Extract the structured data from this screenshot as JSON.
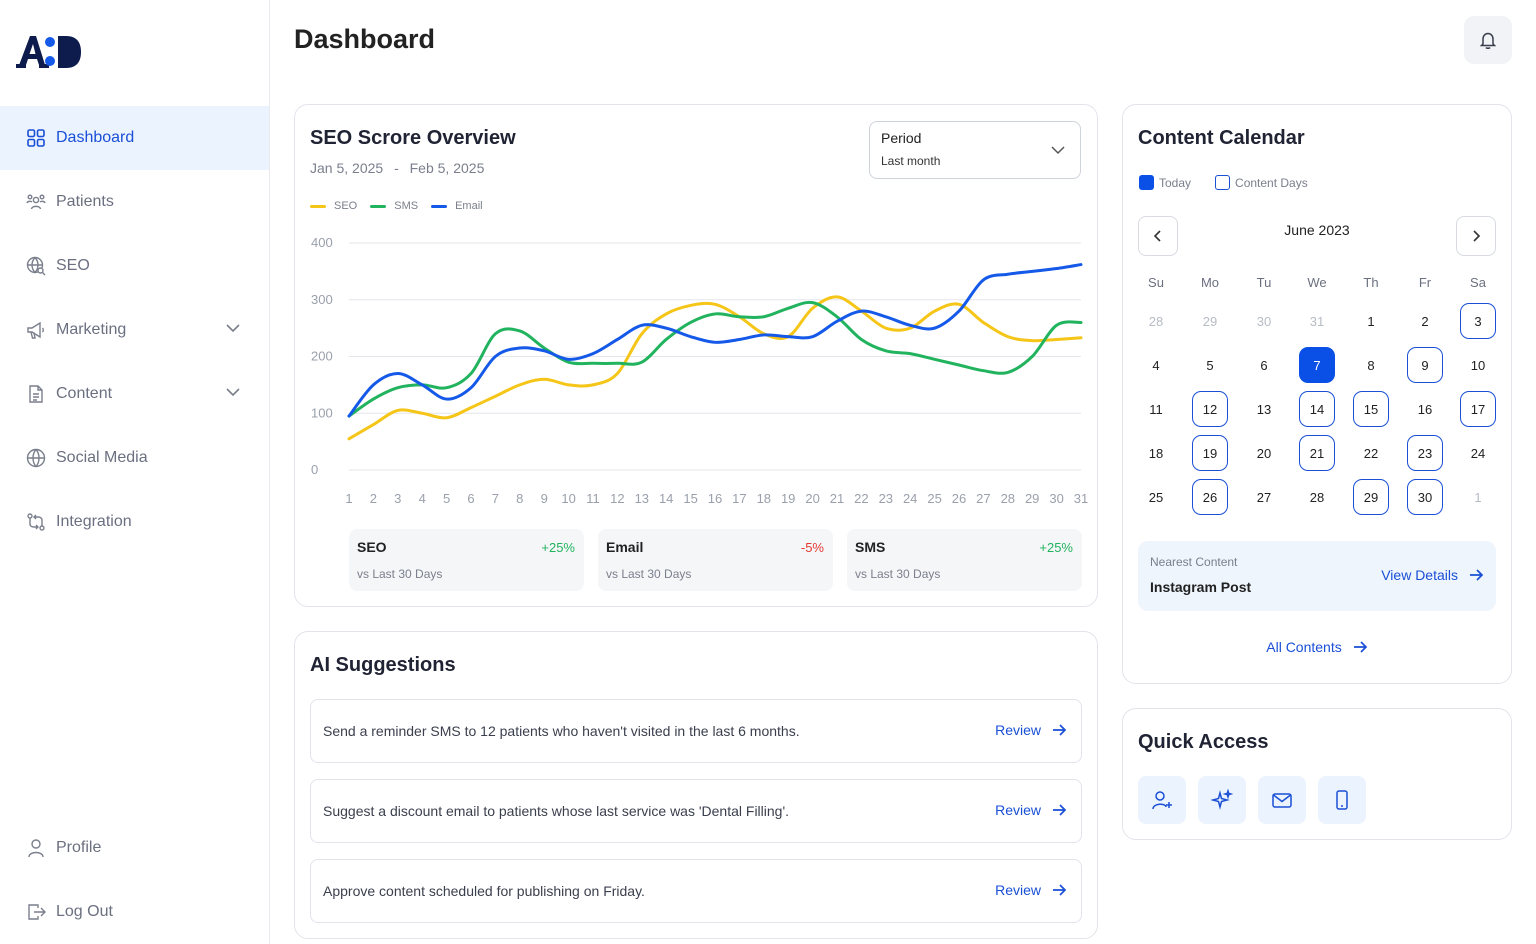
{
  "sidebar": {
    "items": [
      {
        "label": "Dashboard"
      },
      {
        "label": "Patients"
      },
      {
        "label": "SEO"
      },
      {
        "label": "Marketing"
      },
      {
        "label": "Content"
      },
      {
        "label": "Social Media"
      },
      {
        "label": "Integration"
      }
    ],
    "profile_label": "Profile",
    "logout_label": "Log Out"
  },
  "header": {
    "title": "Dashboard"
  },
  "seo_card": {
    "title": "SEO Scrore Overview",
    "date_start": "Jan 5, 2025",
    "date_sep": "-",
    "date_end": "Feb 5, 2025",
    "period_label": "Period",
    "period_value": "Last month",
    "legend": [
      "SEO",
      "SMS",
      "Email"
    ],
    "stats": [
      {
        "name": "SEO",
        "change": "+25%",
        "sub": "vs Last 30 Days"
      },
      {
        "name": "Email",
        "change": "-5%",
        "sub": "vs Last 30 Days"
      },
      {
        "name": "SMS",
        "change": "+25%",
        "sub": "vs Last 30 Days"
      }
    ]
  },
  "colors": {
    "seo": "#f5c518",
    "sms": "#22b35e",
    "email": "#1559e8",
    "accent": "#1a4fd6",
    "positive": "#22b35e",
    "negative": "#e53935"
  },
  "chart_data": {
    "type": "line",
    "x": [
      1,
      2,
      3,
      4,
      5,
      6,
      7,
      8,
      9,
      10,
      11,
      12,
      13,
      14,
      15,
      16,
      17,
      18,
      19,
      20,
      21,
      22,
      23,
      24,
      25,
      26,
      27,
      28,
      29,
      30,
      31
    ],
    "ylim": [
      0,
      400
    ],
    "yticks": [
      0,
      100,
      200,
      300,
      400
    ],
    "grid": true,
    "legend_position": "top-left",
    "series": [
      {
        "name": "SEO",
        "values": [
          55,
          80,
          105,
          100,
          92,
          110,
          130,
          150,
          160,
          150,
          150,
          170,
          240,
          275,
          290,
          292,
          270,
          240,
          235,
          285,
          305,
          280,
          250,
          250,
          280,
          292,
          260,
          235,
          228,
          230,
          233
        ]
      },
      {
        "name": "SMS",
        "values": [
          95,
          125,
          145,
          150,
          145,
          170,
          240,
          245,
          215,
          190,
          188,
          188,
          190,
          230,
          260,
          275,
          270,
          270,
          285,
          295,
          270,
          230,
          210,
          205,
          195,
          185,
          175,
          172,
          200,
          255,
          260
        ]
      },
      {
        "name": "Email",
        "values": [
          95,
          150,
          170,
          150,
          125,
          145,
          200,
          215,
          210,
          195,
          205,
          230,
          255,
          250,
          235,
          225,
          230,
          238,
          235,
          235,
          262,
          280,
          270,
          255,
          250,
          280,
          335,
          345,
          350,
          355,
          362
        ]
      }
    ]
  },
  "ai": {
    "title": "AI Suggestions",
    "review_label": "Review",
    "items": [
      "Send a reminder SMS to 12 patients who haven't visited in the last 6 months.",
      "Suggest a discount email to patients whose last service was 'Dental Filling'.",
      "Approve content scheduled for publishing on Friday."
    ]
  },
  "calendar": {
    "title": "Content Calendar",
    "legend_today": "Today",
    "legend_content": "Content Days",
    "month": "June 2023",
    "dow": [
      "Su",
      "Mo",
      "Tu",
      "We",
      "Th",
      "Fr",
      "Sa"
    ],
    "days": [
      {
        "d": "28",
        "t": "muted"
      },
      {
        "d": "29",
        "t": "muted"
      },
      {
        "d": "30",
        "t": "muted"
      },
      {
        "d": "31",
        "t": "muted"
      },
      {
        "d": "1",
        "t": ""
      },
      {
        "d": "2",
        "t": ""
      },
      {
        "d": "3",
        "t": "cd"
      },
      {
        "d": "4",
        "t": ""
      },
      {
        "d": "5",
        "t": ""
      },
      {
        "d": "6",
        "t": ""
      },
      {
        "d": "7",
        "t": "today"
      },
      {
        "d": "8",
        "t": ""
      },
      {
        "d": "9",
        "t": "cd"
      },
      {
        "d": "10",
        "t": ""
      },
      {
        "d": "11",
        "t": ""
      },
      {
        "d": "12",
        "t": "cd"
      },
      {
        "d": "13",
        "t": ""
      },
      {
        "d": "14",
        "t": "cd"
      },
      {
        "d": "15",
        "t": "cd"
      },
      {
        "d": "16",
        "t": ""
      },
      {
        "d": "17",
        "t": "cd"
      },
      {
        "d": "18",
        "t": ""
      },
      {
        "d": "19",
        "t": "cd"
      },
      {
        "d": "20",
        "t": ""
      },
      {
        "d": "21",
        "t": "cd"
      },
      {
        "d": "22",
        "t": ""
      },
      {
        "d": "23",
        "t": "cd"
      },
      {
        "d": "24",
        "t": ""
      },
      {
        "d": "25",
        "t": ""
      },
      {
        "d": "26",
        "t": "cd"
      },
      {
        "d": "27",
        "t": ""
      },
      {
        "d": "28",
        "t": ""
      },
      {
        "d": "29",
        "t": "cd"
      },
      {
        "d": "30",
        "t": "cd"
      },
      {
        "d": "1",
        "t": "muted"
      }
    ],
    "nearest_label": "Nearest Content",
    "nearest_value": "Instagram Post",
    "view_details": "View Details",
    "all_contents": "All Contents"
  },
  "quick_access": {
    "title": "Quick Access",
    "icons": [
      "add-user-icon",
      "sparkles-icon",
      "mail-icon",
      "phone-icon"
    ]
  }
}
